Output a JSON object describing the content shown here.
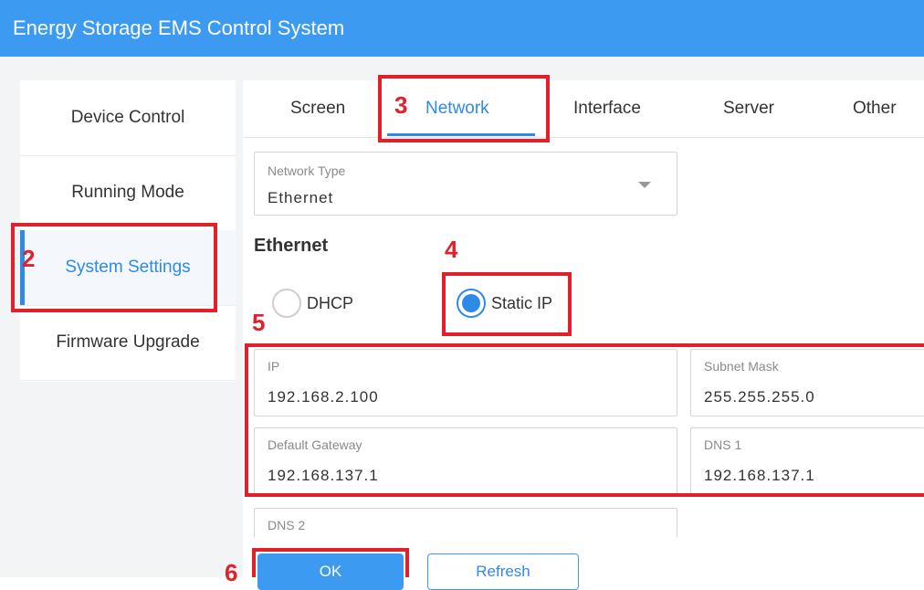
{
  "app": {
    "title": "Energy Storage EMS Control System"
  },
  "sidebar": {
    "items": [
      {
        "label": "Device Control"
      },
      {
        "label": "Running Mode"
      },
      {
        "label": "System Settings"
      },
      {
        "label": "Firmware Upgrade"
      }
    ],
    "active_item": "System Settings"
  },
  "tabs": {
    "items": [
      {
        "label": "Screen"
      },
      {
        "label": "Network"
      },
      {
        "label": "Interface"
      },
      {
        "label": "Server"
      },
      {
        "label": "Other"
      }
    ],
    "active_tab": "Network"
  },
  "network_type": {
    "label": "Network Type",
    "value": "Ethernet"
  },
  "ethernet": {
    "title": "Ethernet",
    "modes": [
      {
        "label": "DHCP",
        "checked": false
      },
      {
        "label": "Static IP",
        "checked": true
      }
    ],
    "fields": {
      "ip": {
        "label": "IP",
        "value": "192.168.2.100"
      },
      "subnet_mask": {
        "label": "Subnet Mask",
        "value": "255.255.255.0"
      },
      "default_gateway": {
        "label": "Default Gateway",
        "value": "192.168.137.1"
      },
      "dns1": {
        "label": "DNS 1",
        "value": "192.168.137.1"
      },
      "dns2": {
        "label": "DNS 2",
        "value": ""
      }
    }
  },
  "buttons": {
    "ok": "OK",
    "refresh": "Refresh"
  },
  "annotations": {
    "step2": "2",
    "step3": "3",
    "step4": "4",
    "step5": "5",
    "step6": "6"
  },
  "colors": {
    "accent": "#3c9bf0",
    "highlight": "#e0202b"
  }
}
